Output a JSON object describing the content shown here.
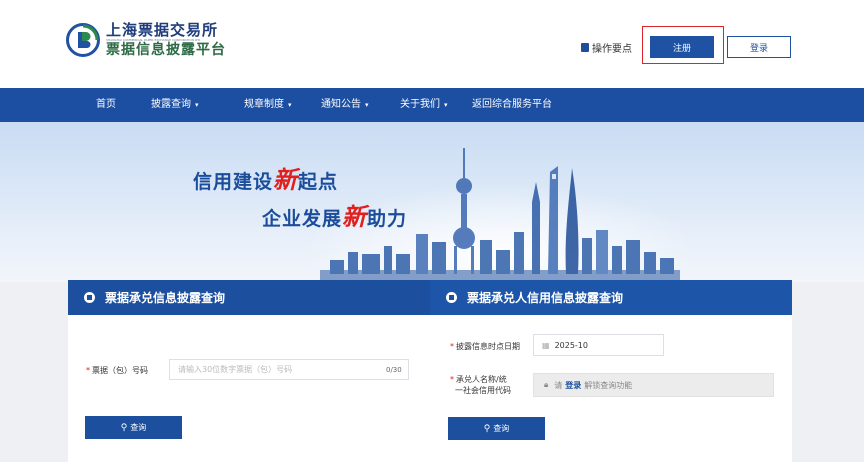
{
  "header": {
    "logo_line1": "上海票据交易所",
    "logo_en": "SHANGHAI COMMERCIAL PAPER EXCHANGE CORPORATION LTD.",
    "logo_line2": "票据信息披露平台",
    "guide_label": "操作要点",
    "register_label": "注册",
    "login_label": "登录",
    "logo_icon": "shpe-logo-icon",
    "guide_icon": "book-icon",
    "colors": {
      "brand_blue": "#1f52a3",
      "highlight": "#d8262a"
    }
  },
  "nav": {
    "items": [
      {
        "label": "首页",
        "dropdown": false
      },
      {
        "label": "披露查询",
        "dropdown": true
      },
      {
        "label": "规章制度",
        "dropdown": true
      },
      {
        "label": "通知公告",
        "dropdown": true
      },
      {
        "label": "关于我们",
        "dropdown": true
      },
      {
        "label": "返回综合服务平台",
        "dropdown": false
      }
    ],
    "caret": "▾"
  },
  "banner": {
    "slogan1_pre": "信用建设",
    "slogan1_red": "新",
    "slogan1_post": "起点",
    "slogan2_pre": "企业发展",
    "slogan2_red": "新",
    "slogan2_post": "助力"
  },
  "left_panel": {
    "title": "票据承兑信息披露查询",
    "field_label": "票据（包）号码",
    "field_placeholder": "请输入30位数字票据（包）号码",
    "field_count": "0/30",
    "query_label": "查询"
  },
  "right_panel": {
    "title": "票据承兑人信用信息披露查询",
    "date_label": "披露信息时点日期",
    "date_value": "2025-10",
    "name_label_1": "承兑人名称/统",
    "name_label_2": "一社会信用代码",
    "lock_pre": "请",
    "lock_link": "登录",
    "lock_post": "解锁查询功能",
    "query_label": "查询"
  }
}
